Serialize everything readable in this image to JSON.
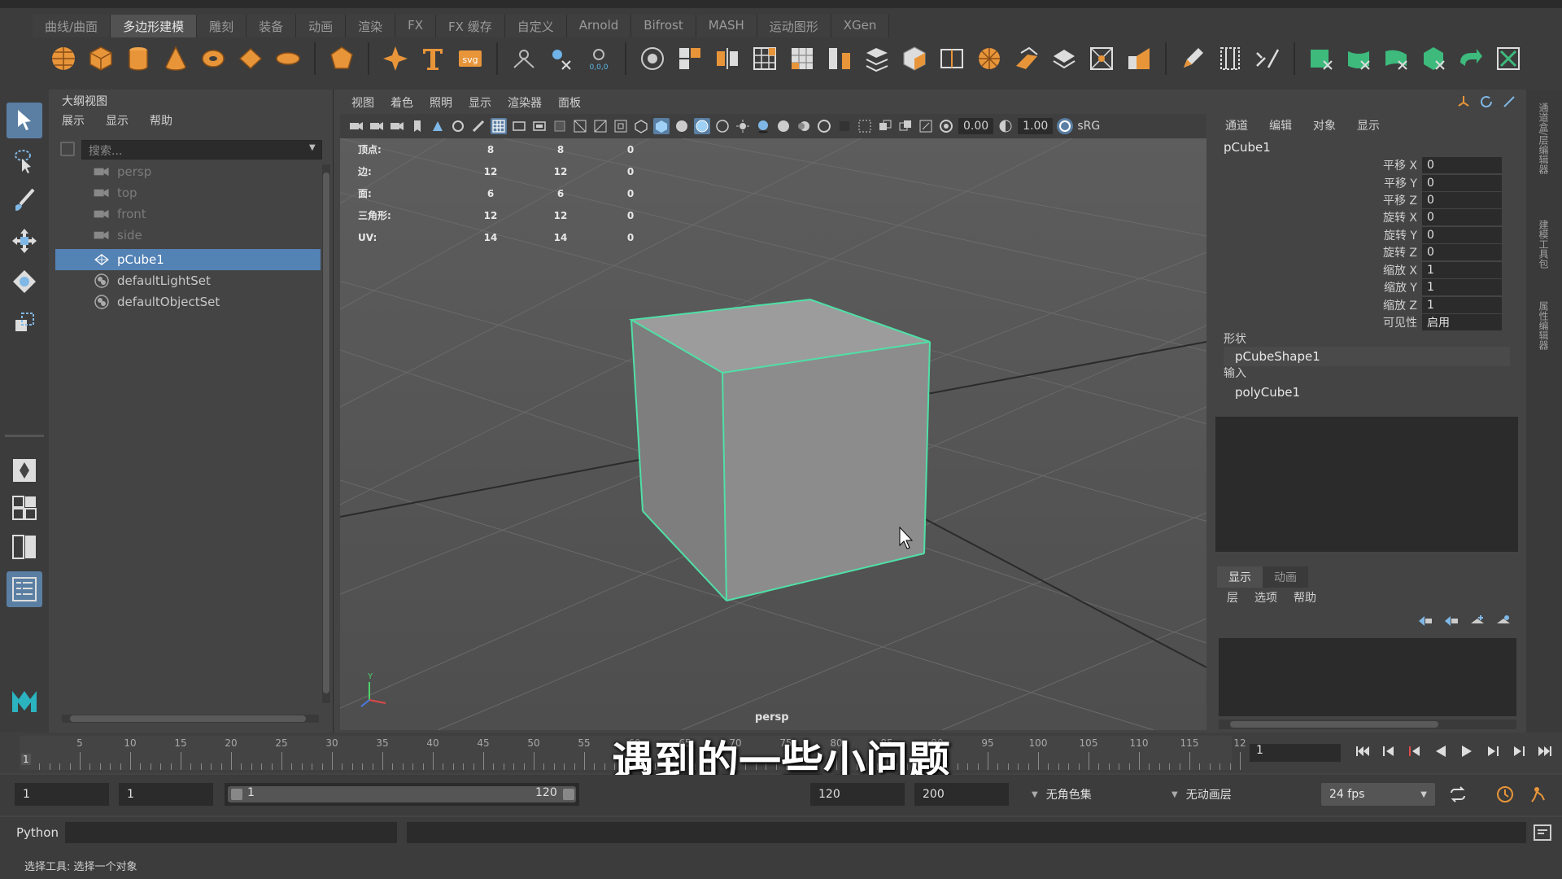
{
  "shelf": {
    "tabs": [
      "曲线/曲面",
      "多边形建模",
      "雕刻",
      "装备",
      "动画",
      "渲染",
      "FX",
      "FX 缓存",
      "自定义",
      "Arnold",
      "Bifrost",
      "MASH",
      "运动图形",
      "XGen"
    ],
    "active_tab": "多边形建模",
    "accent_orange": "#e8953a",
    "accent_green": "#3dba7c"
  },
  "outliner": {
    "title": "大纲视图",
    "menu": [
      "展示",
      "显示",
      "帮助"
    ],
    "search_placeholder": "搜索...",
    "items": [
      {
        "label": "persp",
        "type": "camera",
        "dim": true
      },
      {
        "label": "top",
        "type": "camera",
        "dim": true
      },
      {
        "label": "front",
        "type": "camera",
        "dim": true
      },
      {
        "label": "side",
        "type": "camera",
        "dim": true
      },
      {
        "label": "pCube1",
        "type": "mesh",
        "selected": true
      },
      {
        "label": "defaultLightSet",
        "type": "set"
      },
      {
        "label": "defaultObjectSet",
        "type": "set"
      }
    ]
  },
  "viewport": {
    "menu": [
      "视图",
      "着色",
      "照明",
      "显示",
      "渲染器",
      "面板"
    ],
    "exposure": "0.00",
    "gamma": "1.00",
    "colorspace": "sRG",
    "camera_label": "persp",
    "hud": [
      {
        "label": "顶点:",
        "a": "8",
        "b": "8",
        "c": "0"
      },
      {
        "label": "边:",
        "a": "12",
        "b": "12",
        "c": "0"
      },
      {
        "label": "面:",
        "a": "6",
        "b": "6",
        "c": "0"
      },
      {
        "label": "三角形:",
        "a": "12",
        "b": "12",
        "c": "0"
      },
      {
        "label": "UV:",
        "a": "14",
        "b": "14",
        "c": "0"
      }
    ],
    "selection_color": "#4fe0a6"
  },
  "channel_box": {
    "menu": [
      "通道",
      "编辑",
      "对象",
      "显示"
    ],
    "object": "pCube1",
    "attributes": [
      {
        "label": "平移 X",
        "value": "0"
      },
      {
        "label": "平移 Y",
        "value": "0"
      },
      {
        "label": "平移 Z",
        "value": "0"
      },
      {
        "label": "旋转 X",
        "value": "0"
      },
      {
        "label": "旋转 Y",
        "value": "0"
      },
      {
        "label": "旋转 Z",
        "value": "0"
      },
      {
        "label": "缩放 X",
        "value": "1"
      },
      {
        "label": "缩放 Y",
        "value": "1"
      },
      {
        "label": "缩放 Z",
        "value": "1"
      },
      {
        "label": "可见性",
        "value": "启用"
      }
    ],
    "shape_header": "形状",
    "shape_node": "pCubeShape1",
    "input_header": "输入",
    "input_node": "polyCube1"
  },
  "layers": {
    "tabs": [
      "显示",
      "动画"
    ],
    "menu": [
      "层",
      "选项",
      "帮助"
    ]
  },
  "side_tabs": [
    "通道盒/层编辑器",
    "建模工具包",
    "属性编辑器"
  ],
  "timeline": {
    "labels": [
      "5",
      "10",
      "15",
      "20",
      "25",
      "30",
      "35",
      "40",
      "45",
      "50",
      "55",
      "60",
      "65",
      "70",
      "75",
      "80",
      "85",
      "90",
      "95",
      "100",
      "105",
      "110",
      "115",
      "12"
    ],
    "current_frame": "1",
    "start_marker": "1"
  },
  "range": {
    "start": "1",
    "playback_start": "1",
    "slider_start": "1",
    "slider_end": "120",
    "playback_end": "120",
    "end": "200",
    "char_set": "无角色集",
    "anim_layer": "无动画层",
    "fps": "24 fps"
  },
  "command": {
    "lang": "Python"
  },
  "status": {
    "text": "选择工具: 选择一个对象"
  },
  "subtitle": "遇到的一些小问题"
}
